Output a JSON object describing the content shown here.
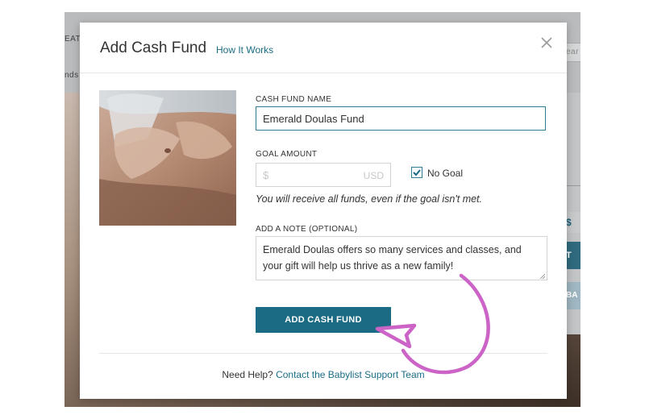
{
  "background": {
    "top_label_1": "EAT",
    "top_label_2": "nds",
    "right_label_1": "ear",
    "right_dollar": "$",
    "right_btn_1": "T",
    "right_btn_2": "BA"
  },
  "modal": {
    "title": "Add Cash Fund",
    "how_it_works": "How It Works",
    "close_icon": "close-icon"
  },
  "form": {
    "name_label": "CASH FUND NAME",
    "name_value": "Emerald Doulas Fund",
    "goal_label": "GOAL AMOUNT",
    "goal_currency_symbol": "$",
    "goal_currency_code": "USD",
    "goal_value": "",
    "no_goal_label": "No Goal",
    "no_goal_checked": true,
    "goal_hint": "You will receive all funds, even if the goal isn't met.",
    "note_label": "ADD A NOTE (OPTIONAL)",
    "note_value": "Emerald Doulas offers so many services and classes, and your gift will help us thrive as a new family!",
    "submit_label": "ADD CASH FUND"
  },
  "footer": {
    "help_prefix": "Need Help?",
    "help_link": "Contact the Babylist Support Team"
  },
  "colors": {
    "accent": "#1a6b83",
    "link": "#1b6d86",
    "annotation": "#cc63c7"
  }
}
